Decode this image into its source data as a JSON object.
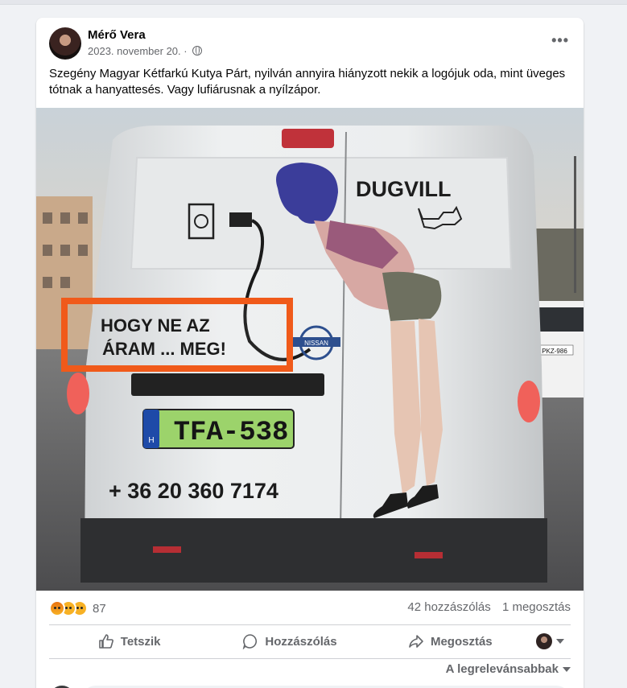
{
  "post": {
    "author": "Mérő Vera",
    "date": "2023. november 20. ·",
    "text": "Szegény Magyar Kétfarkú Kutya Párt, nyilván annyira hiányzott nekik a logójuk oda, mint üveges tótnak a hanyattesés. Vagy lufiárusnak a nyílzápor.",
    "more_label": "•••"
  },
  "image": {
    "slogan_line1": "HOGY NE AZ",
    "slogan_line2": "ÁRAM ... MEG!",
    "brand": "DUGVILL",
    "plate": "TFA-538",
    "plate_country": "H",
    "phone": "+ 36 20 360 7174",
    "car_badge": "NISSAN",
    "right_plate": "PKZ-986"
  },
  "engagement": {
    "reaction_count": "87",
    "comments": "42 hozzászólás",
    "shares": "1 megosztás"
  },
  "actions": {
    "like": "Tetszik",
    "comment": "Hozzászólás",
    "share": "Megosztás"
  },
  "sort_label": "A legrelevánsabbak",
  "icons": [
    "globe-icon",
    "more-icon",
    "like-icon",
    "comment-icon",
    "share-icon",
    "caret-down-icon"
  ],
  "colors": {
    "highlight_box": "#f05a1a",
    "plate_green": "#9cd36b",
    "text_secondary": "#65676b"
  }
}
